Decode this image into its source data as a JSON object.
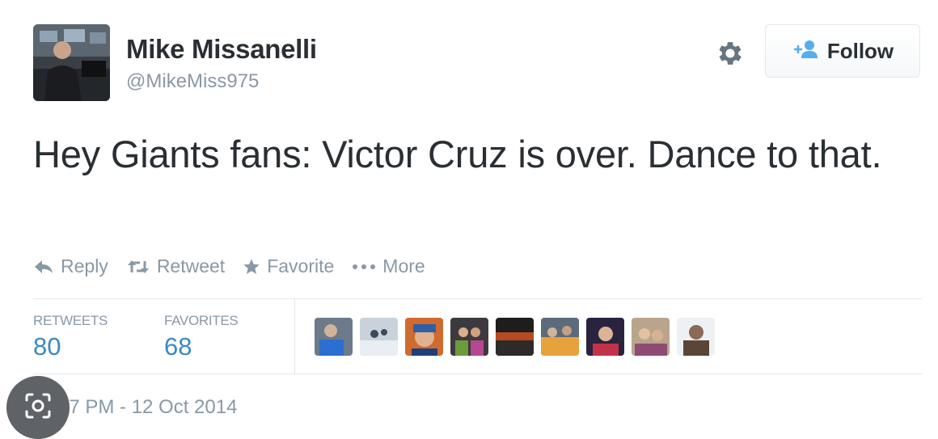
{
  "user": {
    "name": "Mike Missanelli",
    "handle": "@MikeMiss975"
  },
  "header": {
    "follow_label": "Follow",
    "settings_icon": "gear-icon",
    "follow_icon": "add-user-icon"
  },
  "tweet": {
    "text": "Hey Giants fans: Victor Cruz is over. Dance to that."
  },
  "actions": [
    {
      "label": "Reply",
      "icon": "reply-icon"
    },
    {
      "label": "Retweet",
      "icon": "retweet-icon"
    },
    {
      "label": "Favorite",
      "icon": "star-icon"
    },
    {
      "label": "More",
      "icon": "more-icon"
    }
  ],
  "stats": {
    "retweets_label": "RETWEETS",
    "retweets_value": "80",
    "favorites_label": "FAVORITES",
    "favorites_value": "68"
  },
  "favoriters_count_shown": 9,
  "timestamp": "27 PM - 12 Oct 2014",
  "colors": {
    "text": "#292f33",
    "muted": "#8899a6",
    "link_blue": "#3b88c3",
    "divider": "#e1e8ed",
    "follow_icon_blue": "#55acee"
  }
}
